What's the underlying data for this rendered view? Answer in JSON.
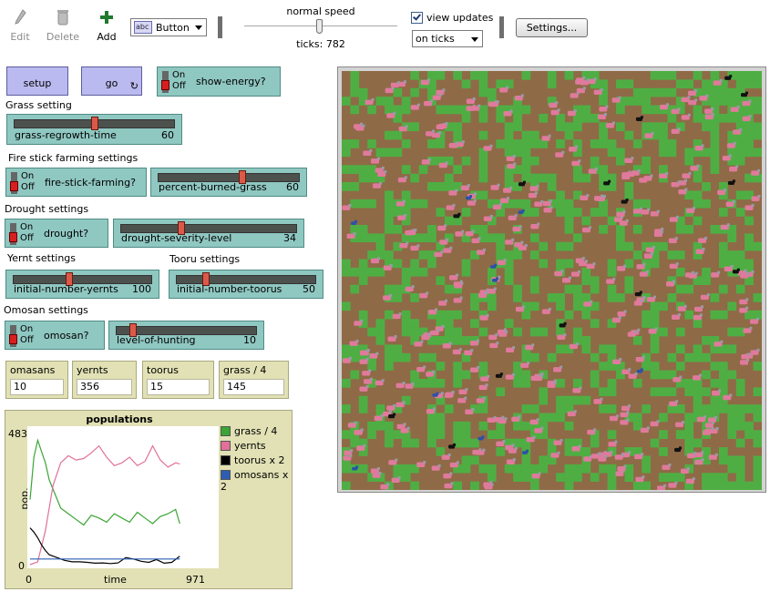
{
  "toolbar": {
    "edit_label": "Edit",
    "delete_label": "Delete",
    "add_label": "Add",
    "widget_type": "Button",
    "speed_label": "normal speed",
    "ticks_label": "ticks:",
    "ticks_value": "782",
    "speed_fraction": 0.5,
    "view_updates_label": "view updates",
    "view_updates_checked": true,
    "update_mode": "on ticks",
    "settings_label": "Settings..."
  },
  "buttons": {
    "setup": "setup",
    "go": "go"
  },
  "switches": {
    "on": "On",
    "off": "Off",
    "show_energy": "show-energy?",
    "fire_stick": "fire-stick-farming?",
    "drought": "drought?",
    "omosan": "omosan?"
  },
  "sections": {
    "grass": "Grass setting",
    "fire_stick": "Fire stick farming settings",
    "drought": "Drought settings",
    "yernt": "Yernt settings",
    "tooru": "Tooru settings",
    "omosan": "Omosan settings"
  },
  "sliders": {
    "grass_regrowth": {
      "name": "grass-regrowth-time",
      "value": "60",
      "fraction": 0.5
    },
    "percent_burned": {
      "name": "percent-burned-grass",
      "value": "60",
      "fraction": 0.6
    },
    "drought_severity": {
      "name": "drought-severity-level",
      "value": "34",
      "fraction": 0.34
    },
    "init_yernts": {
      "name": "initial-number-yernts",
      "value": "100",
      "fraction": 0.4
    },
    "init_toorus": {
      "name": "initial-number-toorus",
      "value": "50",
      "fraction": 0.2
    },
    "hunting": {
      "name": "level-of-hunting",
      "value": "10",
      "fraction": 0.1
    }
  },
  "monitors": [
    {
      "label": "omasans",
      "value": "10"
    },
    {
      "label": "yernts",
      "value": "356"
    },
    {
      "label": "toorus",
      "value": "15"
    },
    {
      "label": "grass / 4",
      "value": "145"
    }
  ],
  "plot": {
    "title": "populations",
    "ylabel": "pop.",
    "xlabel": "time",
    "y_max_label": "483",
    "y_min_label": "0",
    "x_min_label": "0",
    "x_max_label": "971"
  },
  "chart_data": {
    "type": "line",
    "title": "populations",
    "xlabel": "time",
    "ylabel": "pop.",
    "xlim": [
      0,
      971
    ],
    "ylim": [
      0,
      483
    ],
    "legend_position": "right",
    "series": [
      {
        "name": "grass / 4",
        "color": "#3aa534",
        "x": [
          0,
          20,
          40,
          60,
          80,
          100,
          130,
          160,
          200,
          240,
          280,
          320,
          360,
          400,
          440,
          480,
          520,
          560,
          600,
          640,
          680,
          720,
          760,
          782
        ],
        "y": [
          230,
          380,
          440,
          400,
          360,
          300,
          250,
          200,
          180,
          160,
          140,
          175,
          165,
          150,
          180,
          165,
          150,
          185,
          165,
          145,
          170,
          180,
          195,
          145
        ]
      },
      {
        "name": "yernts",
        "color": "#e2709a",
        "x": [
          0,
          40,
          80,
          120,
          160,
          200,
          240,
          280,
          320,
          360,
          400,
          440,
          480,
          520,
          560,
          600,
          640,
          680,
          720,
          760,
          782
        ],
        "y": [
          0,
          10,
          120,
          280,
          360,
          385,
          370,
          375,
          395,
          420,
          380,
          350,
          360,
          380,
          350,
          365,
          420,
          370,
          345,
          360,
          356
        ]
      },
      {
        "name": "toorus x 2",
        "color": "#000000",
        "x": [
          0,
          20,
          40,
          60,
          80,
          100,
          140,
          180,
          220,
          260,
          300,
          340,
          380,
          420,
          460,
          500,
          540,
          580,
          620,
          660,
          700,
          740,
          782
        ],
        "y": [
          130,
          115,
          95,
          70,
          50,
          35,
          25,
          15,
          10,
          10,
          8,
          5,
          6,
          4,
          6,
          25,
          20,
          12,
          8,
          18,
          5,
          8,
          30
        ]
      },
      {
        "name": "omosans x 2",
        "color": "#2d5eb0",
        "x": [
          0,
          100,
          200,
          300,
          400,
          500,
          600,
          700,
          782
        ],
        "y": [
          20,
          20,
          20,
          20,
          20,
          20,
          20,
          20,
          20
        ]
      }
    ]
  },
  "colors": {
    "ground": "#8f6a47",
    "grass": "#4fae43",
    "sheep": "#e07a9c",
    "wolf": "#111111",
    "hunter": "#2a52a8"
  },
  "world": {
    "cols": 49,
    "rows": 49,
    "seed": 7,
    "grass_fraction": 0.35,
    "sheep_count": 356,
    "wolf_count": 15,
    "hunter_count": 10
  }
}
